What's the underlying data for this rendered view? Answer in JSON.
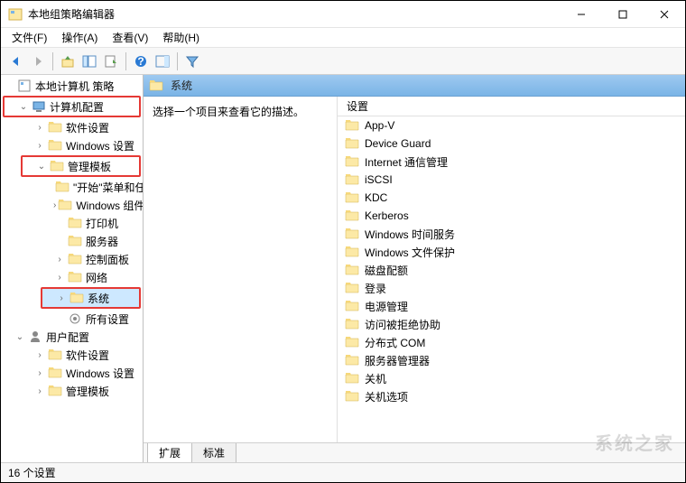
{
  "title": "本地组策略编辑器",
  "menus": [
    "文件(F)",
    "操作(A)",
    "查看(V)",
    "帮助(H)"
  ],
  "toolbar_icons": [
    "back",
    "forward",
    "up",
    "show-hide-tree",
    "export-list",
    "refresh",
    "help",
    "show-hide-action",
    "filter"
  ],
  "tree": {
    "root": "本地计算机 策略",
    "computer_config": "计算机配置",
    "software_settings": "软件设置",
    "windows_settings": "Windows 设置",
    "admin_templates": "管理模板",
    "start_menu": "\"开始\"菜单和任务栏",
    "windows_components": "Windows 组件",
    "printers": "打印机",
    "server": "服务器",
    "control_panel": "控制面板",
    "network": "网络",
    "system": "系统",
    "all_settings": "所有设置",
    "user_config": "用户配置",
    "u_software_settings": "软件设置",
    "u_windows_settings": "Windows 设置",
    "u_admin_templates": "管理模板"
  },
  "header_title": "系统",
  "description": "选择一个项目来查看它的描述。",
  "list_header": "设置",
  "items": [
    "App-V",
    "Device Guard",
    "Internet 通信管理",
    "iSCSI",
    "KDC",
    "Kerberos",
    "Windows 时间服务",
    "Windows 文件保护",
    "磁盘配额",
    "登录",
    "电源管理",
    "访问被拒绝协助",
    "分布式 COM",
    "服务器管理器",
    "关机",
    "关机选项"
  ],
  "tabs": [
    "扩展",
    "标准"
  ],
  "statusbar": "16 个设置"
}
